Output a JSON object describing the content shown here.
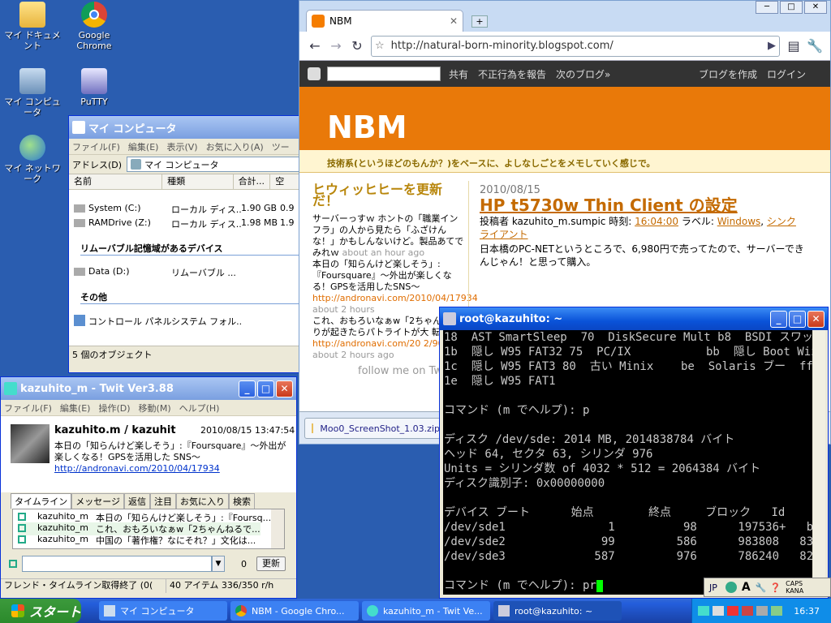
{
  "desktop": {
    "icons": [
      {
        "label": "マイ ドキュメント",
        "icon": "folder-documents-icon"
      },
      {
        "label": "Google Chrome",
        "icon": "chrome-icon"
      },
      {
        "label": "マイ コンピュータ",
        "icon": "computer-icon"
      },
      {
        "label": "PuTTY",
        "icon": "putty-icon"
      },
      {
        "label": "マイ ネットワーク",
        "icon": "network-icon"
      }
    ]
  },
  "explorer": {
    "title": "マイ コンピュータ",
    "menu": [
      "ファイル(F)",
      "編集(E)",
      "表示(V)",
      "お気に入り(A)",
      "ツー"
    ],
    "address_label": "アドレス(D)",
    "address_value": "マイ コンピュータ",
    "columns": [
      "名前",
      "種類",
      "合計...",
      "空"
    ],
    "rows": [
      {
        "name": "System (C:)",
        "type": "ローカル ディス...",
        "total": "1.90 GB",
        "free": "0.9"
      },
      {
        "name": "RAMDrive (Z:)",
        "type": "ローカル ディス...",
        "total": "1.98 MB",
        "free": "1.9"
      }
    ],
    "group_removable": "リムーバブル記憶域があるデバイス",
    "removable_rows": [
      {
        "name": "Data (D:)",
        "type": "リムーバブル ..."
      }
    ],
    "group_other": "その他",
    "other_rows": [
      {
        "name": "コントロール パネル",
        "type": "システム フォル..."
      }
    ],
    "status": "5 個のオブジェクト"
  },
  "chrome": {
    "tab_title": "NBM",
    "url": "http://natural-born-minority.blogspot.com/",
    "blogger_nav": [
      "共有",
      "不正行為を報告",
      "次のブログ»"
    ],
    "blogger_right": [
      "ブログを作成",
      "ログイン"
    ],
    "blog_title": "NBM",
    "blog_description": "技術系(というほどのもんか？)をベースに、よしなしごとをメモしていく感じで。",
    "sidebar": {
      "heading": "ヒウィッヒヒーを更新だ！",
      "items": [
        {
          "text": "サーバーっすｗ ホントの「職業インフラ」の人から見たら「ふざけんな！」かもしんないけど。製品あてでみれｗ",
          "time": "about an hour ago"
        },
        {
          "text": "本日の「知らんけど楽しそう」:『Foursquare』〜外出が楽しくなる！GPSを活用したSNS〜",
          "link": "http://andronavi.com/2010/04/17934",
          "time": "about 2 hours"
        },
        {
          "text": "これ、おもろいなぁw「2ちゃん で祭りが起きたらパトライトが大 転！」",
          "link": "http://andronavi.com/20 2/9051",
          "time": "about 2 hours ago"
        }
      ],
      "follow": "follow me on Tw"
    },
    "post": {
      "date": "2010/08/15",
      "title": "HP t5730w Thin Client の設定",
      "meta_prefix": "投稿者 kazuhito_m.sumpic 時刻:",
      "time": "16:04:00",
      "label_prefix": "ラベル:",
      "labels": [
        "Windows",
        "シンクライアント"
      ],
      "body": "日本橋のPC-NETというところで、6,980円で売ってたので、サーバーできんじゃん！と思って購入。"
    },
    "download": "Moo0_ScreenShot_1.03.zip"
  },
  "twit": {
    "title": "kazuhito_m - Twit Ver3.88",
    "menu": [
      "ファイル(F)",
      "編集(E)",
      "操作(D)",
      "移動(M)",
      "ヘルプ(H)"
    ],
    "user": "kazuhito.m / kazuhit",
    "date": "2010/08/15 13:47:54",
    "tweet": "本日の「知らんけど楽しそう」:『Foursquare』〜外出が楽しくなる！GPSを活用した SNS〜",
    "tweet_link": "http://andronavi.com/2010/04/17934",
    "tabs": [
      "タイムライン",
      "メッセージ",
      "返信",
      "注目",
      "お気に入り",
      "検索"
    ],
    "timeline": [
      {
        "user": "kazuhito_m",
        "text": "本日の「知らんけど楽しそう」:『Foursq..."
      },
      {
        "user": "kazuhito_m",
        "text": "これ、おもろいなぁw「2ちゃんねるで..."
      },
      {
        "user": "kazuhito_m",
        "text": "中国の「著作権？なにそれ？」文化は..."
      }
    ],
    "count": "0",
    "update_button": "更新",
    "status_left": "フレンド・タイムライン取得終了 (0(",
    "status_right": "40 アイテム 336/350 r/h"
  },
  "terminal": {
    "title": "root@kazuhito: ~",
    "lines": [
      "18  AST SmartSleep  70  DiskSecure Mult b8  BSDI スワッ",
      "1b  隠し W95 FAT32 75  PC/IX           bb  隠し Boot Wiz f",
      "1c  隠し W95 FAT3 80  古い Minix    be  Solaris ブー  ff",
      "1e  隠し W95 FAT1",
      "",
      "コマンド (m でヘルプ): p",
      "",
      "ディスク /dev/sde: 2014 MB, 2014838784 バイト",
      "ヘッド 64, セクタ 63, シリンダ 976",
      "Units = シリンダ数 of 4032 * 512 = 2064384 バイト",
      "ディスク識別子: 0x00000000",
      "",
      "デバイス ブート      始点        終点     ブロック   Id",
      "/dev/sde1               1          98      197536+   b  W",
      "/dev/sde2              99         586      983808   83  L",
      "/dev/sde3             587         976      786240   82  L",
      "",
      "コマンド (m でヘルプ): pr"
    ],
    "ime": [
      "JP",
      "A",
      "CAPS KANA"
    ]
  },
  "taskbar": {
    "start": "スタート",
    "items": [
      "マイ コンピュータ",
      "NBM - Google Chro...",
      "kazuhito_m - Twit Ve...",
      "root@kazuhito: ~"
    ],
    "clock": "16:37"
  }
}
